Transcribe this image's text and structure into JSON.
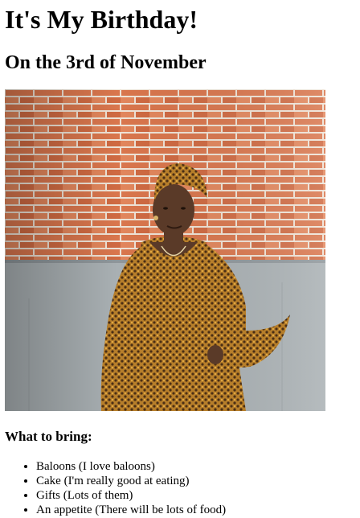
{
  "page": {
    "title": "It's My Birthday!",
    "subtitle": "On the 3rd of November",
    "photo_icon": "woman-portrait-photo",
    "bring_heading": "What to bring:",
    "bring_items": [
      "Baloons (I love baloons)",
      "Cake (I'm really good at eating)",
      "Gifts (Lots of them)",
      "An appetite (There will be lots of food)"
    ]
  },
  "colors": {
    "brick": "#d9764d",
    "mortar": "#efe3d6",
    "wall_base": "#a9b0b3",
    "dress": "#b67e2a",
    "skin": "#5a3a28"
  }
}
